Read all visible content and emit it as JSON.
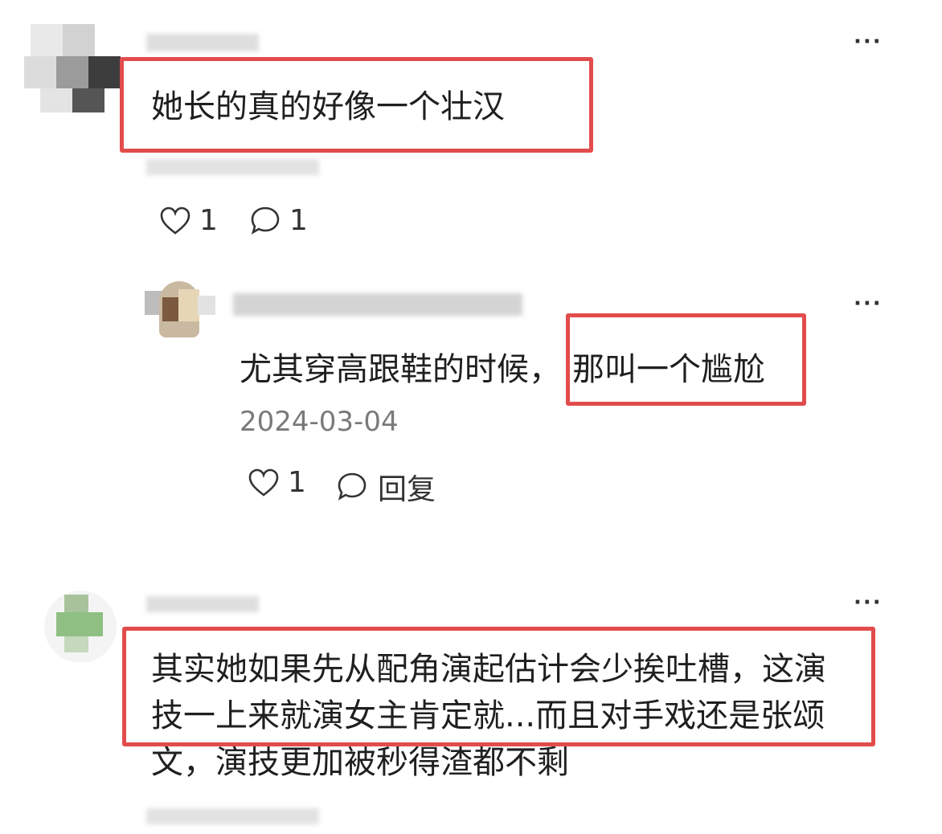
{
  "comments": [
    {
      "text": "她长的真的好像一个壮汉",
      "likes": "1",
      "replies": "1",
      "more_icon": "ellipsis-icon"
    },
    {
      "text_before": "尤其穿高跟鞋的时候，",
      "text_highlight": "那叫一个尴尬",
      "date": "2024-03-04",
      "likes": "1",
      "reply_label": "回复",
      "more_icon": "ellipsis-icon"
    },
    {
      "line1": "其实她如果先从配角演起估计会少挨吐槽，这演",
      "line2": "技一上来就演女主肯定就...而且对手戏还是张颂",
      "line3": "文，演技更加被秒得渣都不剩",
      "more_icon": "ellipsis-icon"
    }
  ],
  "colors": {
    "highlight_border": "#e24c4c",
    "date_gray": "#7a7a7a"
  }
}
